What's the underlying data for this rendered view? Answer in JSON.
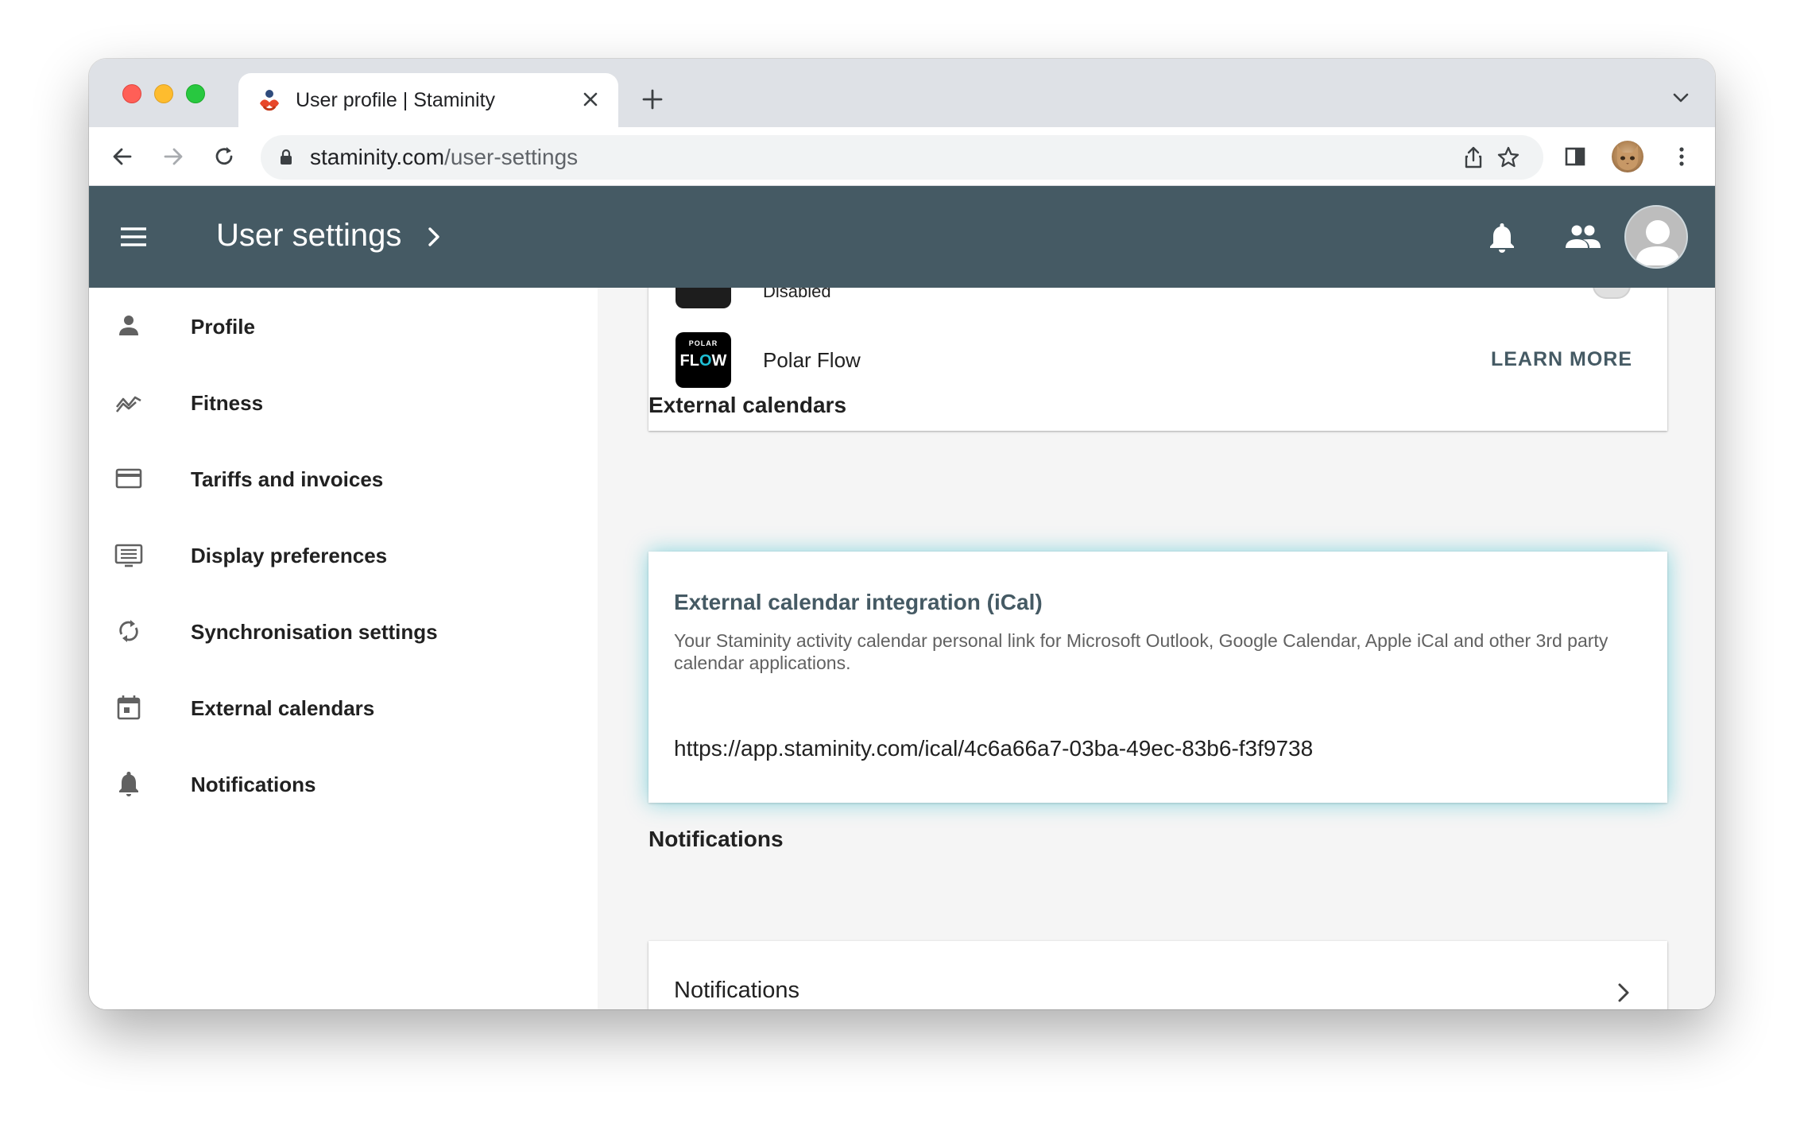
{
  "browser": {
    "tab_title": "User profile | Staminity",
    "url_domain": "staminity.com",
    "url_path": "/user-settings"
  },
  "appbar": {
    "title": "User settings",
    "background": "#455a64"
  },
  "sidebar": {
    "items": [
      {
        "label": "Profile",
        "icon": "person-icon"
      },
      {
        "label": "Fitness",
        "icon": "trending-icon"
      },
      {
        "label": "Tariffs and invoices",
        "icon": "credit-card-icon"
      },
      {
        "label": "Display preferences",
        "icon": "display-icon"
      },
      {
        "label": "Synchronisation settings",
        "icon": "sync-icon"
      },
      {
        "label": "External calendars",
        "icon": "calendar-icon"
      },
      {
        "label": "Notifications",
        "icon": "bell-icon"
      }
    ]
  },
  "services": {
    "previous_status": "Disabled",
    "polar": {
      "logo_top": "POLAR",
      "logo_bottom_1": "FL",
      "logo_bottom_o": "O",
      "logo_bottom_2": "W",
      "name": "Polar Flow",
      "action": "LEARN MORE"
    }
  },
  "external_calendars": {
    "heading": "External calendars",
    "card_title": "External calendar integration (iCal)",
    "description": "Your Staminity activity calendar personal link for Microsoft Outlook, Google Calendar, Apple iCal and other 3rd party calendar applications.",
    "link": "https://app.staminity.com/ical/4c6a66a7-03ba-49ec-83b6-f3f9738"
  },
  "notifications": {
    "heading": "Notifications",
    "item_label": "Notifications"
  }
}
